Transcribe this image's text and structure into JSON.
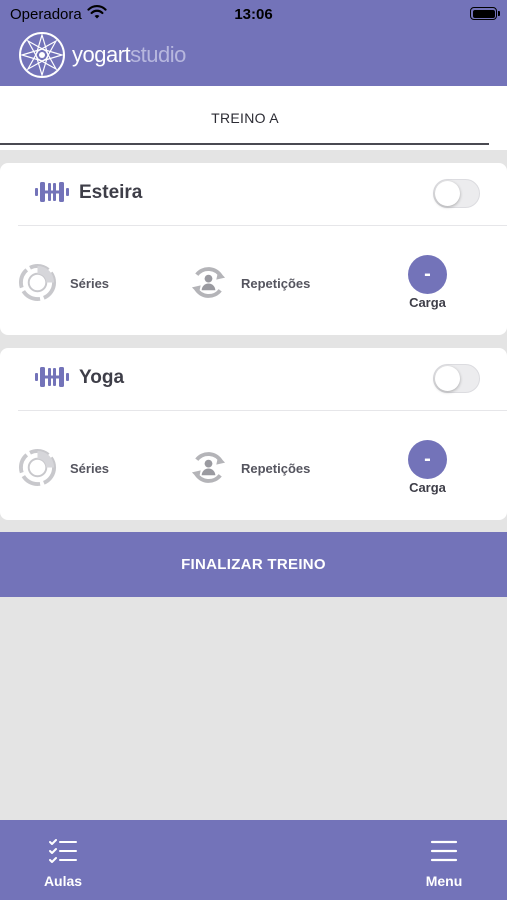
{
  "status_bar": {
    "carrier": "Operadora",
    "time": "13:06"
  },
  "header": {
    "logo_main": "yogart",
    "logo_sub": "studio",
    "brand_color": "#7373b9"
  },
  "tab": {
    "label": "TREINO A"
  },
  "exercises": [
    {
      "name": "Esteira",
      "toggle_on": false,
      "series_label": "Séries",
      "reps_label": "Repetições",
      "carga_value": "-",
      "carga_label": "Carga"
    },
    {
      "name": "Yoga",
      "toggle_on": false,
      "series_label": "Séries",
      "reps_label": "Repetições",
      "carga_value": "-",
      "carga_label": "Carga"
    }
  ],
  "actions": {
    "finish_label": "FINALIZAR TREINO"
  },
  "bottom_nav": {
    "items": [
      {
        "label": "Aulas",
        "icon": "checklist-icon"
      },
      {
        "label": "Menu",
        "icon": "hamburger-menu-icon"
      }
    ]
  }
}
